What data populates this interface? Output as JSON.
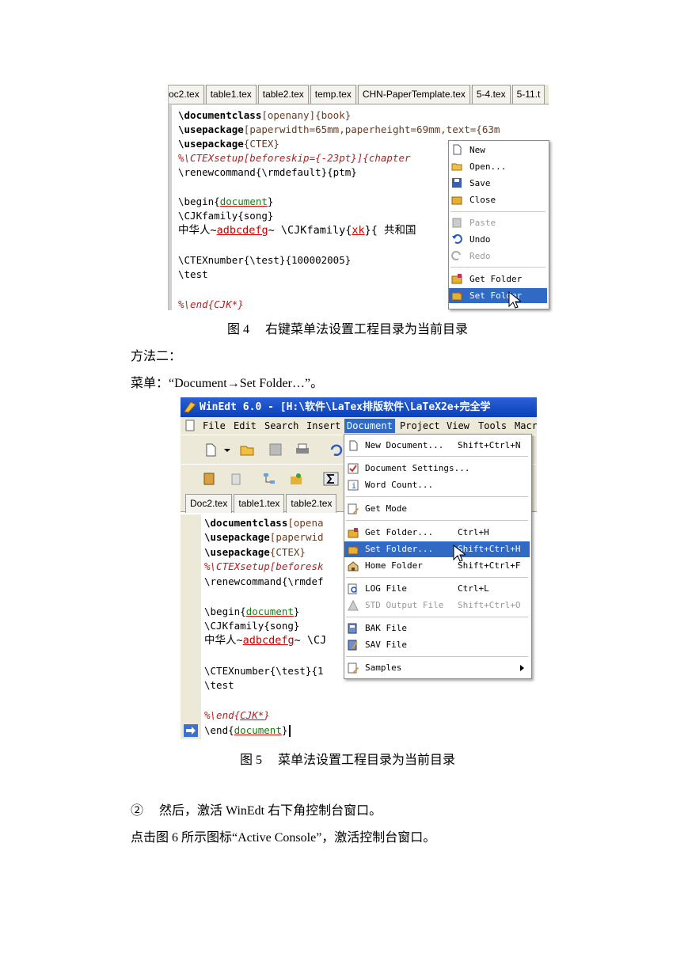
{
  "figure4": {
    "tabs": [
      "oc2.tex",
      "table1.tex",
      "table2.tex",
      "temp.tex",
      "CHN-PaperTemplate.tex",
      "5-4.tex",
      "5-11.t"
    ],
    "code": {
      "l1a": "\\documentclass",
      "l1b": "[openany]{book}",
      "l2a": "\\usepackage",
      "l2b": "[paperwidth=65mm,paperheight=69mm,text={63m",
      "l3a": "\\usepackage",
      "l3b": "{CTEX}",
      "l4": "%\\CTEXsetup[beforeskip={-23pt}]{chapter",
      "l5": "\\renewcommand{\\rmdefault}{ptm}",
      "l6a": "\\begin{",
      "l6b": "document",
      "l6c": "}",
      "l7": "\\CJKfamily{song}",
      "l8a": "中华人~",
      "l8b": "adbcdefg",
      "l8c": "~ \\CJKfamily{",
      "l8d": "xk",
      "l8e": "}{ 共和国",
      "l9": "\\CTEXnumber{\\test}{100002005}",
      "l10": "\\test",
      "l11": "%\\end{CJK*}"
    },
    "context_menu": {
      "new": "New",
      "open": "Open...",
      "save": "Save",
      "close": "Close",
      "paste": "Paste",
      "undo": "Undo",
      "redo": "Redo",
      "get_folder": "Get Folder",
      "set_folder": "Set Folder"
    },
    "caption": "图 4　 右键菜单法设置工程目录为当前目录"
  },
  "method2": "方法二：",
  "menu_line": "菜单：“Document→Set Folder…”。",
  "figure5": {
    "title": "WinEdt 6.0 - [H:\\软件\\LaTex排版软件\\LaTeX2e+完全学",
    "menus": [
      "File",
      "Edit",
      "Search",
      "Insert",
      "Document",
      "Project",
      "View",
      "Tools",
      "Macr"
    ],
    "tabs": [
      "Doc2.tex",
      "table1.tex",
      "table2.tex"
    ],
    "code": {
      "l1a": "\\documentclass",
      "l1b": "[opena",
      "l2a": "\\usepackage",
      "l2b": "[paperwid",
      "l3a": "\\usepackage",
      "l3b": "{CTEX}",
      "l4": "%\\CTEXsetup[beforesk",
      "l5": "\\renewcommand{\\rmdef",
      "l6a": "\\begin{",
      "l6b": "document",
      "l6c": "}",
      "l7": "\\CJKfamily{song}",
      "l8a": "中华人~",
      "l8b": "adbcdefg",
      "l8c": "~ \\CJ",
      "l9": "\\CTEXnumber{\\test}{1",
      "l10": "\\test",
      "l11a": "%\\end{",
      "l11b": "CJK*",
      "l11c": "}",
      "l12a": "\\end{",
      "l12b": "document",
      "l12c": "}"
    },
    "doc_menu": {
      "new_doc": "New Document...",
      "new_doc_sc": "Shift+Ctrl+N",
      "doc_settings": "Document Settings...",
      "word_count": "Word Count...",
      "get_mode": "Get Mode",
      "get_folder": "Get Folder...",
      "get_folder_sc": "Ctrl+H",
      "set_folder": "Set Folder...",
      "set_folder_sc": "Shift+Ctrl+H",
      "home_folder": "Home Folder",
      "home_folder_sc": "Shift+Ctrl+F",
      "log_file": "LOG File",
      "log_file_sc": "Ctrl+L",
      "std_output": "STD Output File",
      "std_output_sc": "Shift+Ctrl+O",
      "bak_file": "BAK File",
      "sav_file": "SAV File",
      "samples": "Samples"
    },
    "caption": "图 5　 菜单法设置工程目录为当前目录"
  },
  "step2": "②　 然后，激活 WinEdt 右下角控制台窗口。",
  "step2_detail": "点击图 6 所示图标“Active Console”，激活控制台窗口。"
}
